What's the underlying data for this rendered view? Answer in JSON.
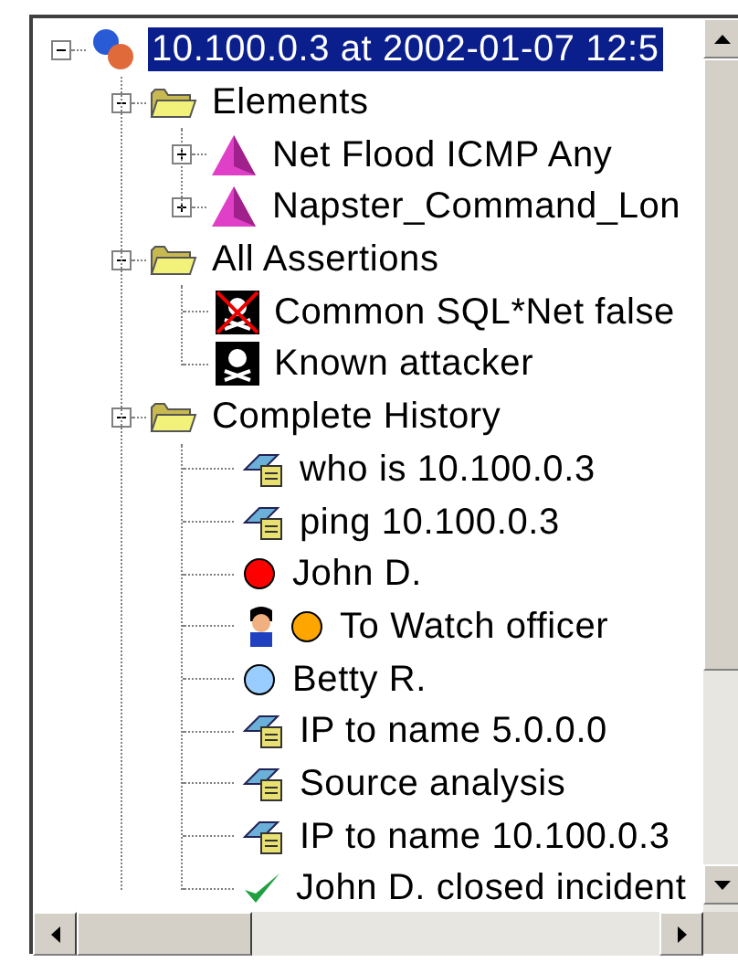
{
  "tree": [
    {
      "label": "10.100.0.3 at 2002-01-07 12:5",
      "kind": "host",
      "expanded": true,
      "selected": true,
      "children": [
        {
          "label": "Elements",
          "kind": "folder",
          "expanded": true,
          "selected": false,
          "children": [
            {
              "label": "Net Flood ICMP Any",
              "kind": "alert",
              "expanded": false,
              "selected": false
            },
            {
              "label": "Napster_Command_Lon",
              "kind": "alert",
              "expanded": false,
              "selected": false
            }
          ]
        },
        {
          "label": "All Assertions",
          "kind": "folder",
          "expanded": true,
          "selected": false,
          "children": [
            {
              "label": "Common SQL*Net false",
              "kind": "skull-crossed",
              "selected": false
            },
            {
              "label": "Known attacker",
              "kind": "skull",
              "selected": false
            }
          ]
        },
        {
          "label": "Complete History",
          "kind": "folder",
          "expanded": true,
          "selected": false,
          "children": [
            {
              "label": "who is 10.100.0.3",
              "kind": "command",
              "selected": false
            },
            {
              "label": "ping 10.100.0.3",
              "kind": "command",
              "selected": false
            },
            {
              "label": "John D.",
              "kind": "dot",
              "color": "#ff0000",
              "selected": false
            },
            {
              "label": "To Watch officer",
              "kind": "officer-dot",
              "color": "#ffa500",
              "selected": false
            },
            {
              "label": "Betty R.",
              "kind": "dot",
              "color": "#99ccff",
              "selected": false
            },
            {
              "label": "IP to name 5.0.0.0",
              "kind": "command",
              "selected": false
            },
            {
              "label": "Source analysis",
              "kind": "command",
              "selected": false
            },
            {
              "label": "IP to name 10.100.0.3",
              "kind": "command",
              "selected": false
            },
            {
              "label": "John D. closed incident",
              "kind": "check",
              "selected": false
            }
          ]
        }
      ]
    }
  ]
}
